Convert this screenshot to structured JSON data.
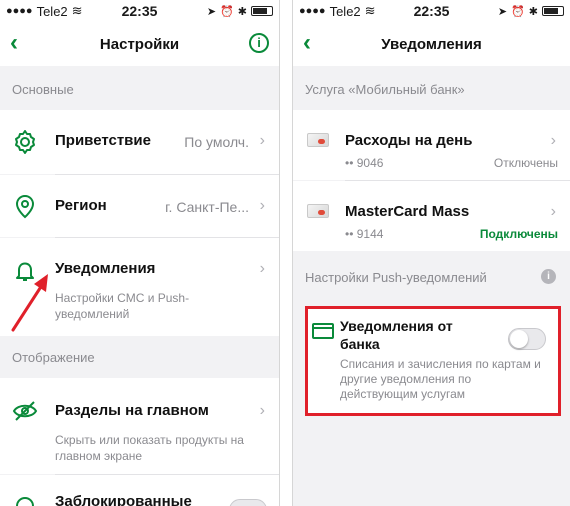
{
  "colors": {
    "accent": "#0a8a3a",
    "highlight": "#e0202a",
    "muted": "#8a8a8f"
  },
  "status": {
    "carrier": "Tele2",
    "time": "22:35"
  },
  "left": {
    "title": "Настройки",
    "sections": {
      "basic": "Основные",
      "display": "Отображение"
    },
    "items": {
      "greeting": {
        "label": "Приветствие",
        "value": "По умолч.",
        "icon": "gear-icon"
      },
      "region": {
        "label": "Регион",
        "value": "г. Санкт-Пе...",
        "icon": "location-pin-icon"
      },
      "notifications": {
        "label": "Уведомления",
        "sub": "Настройки СМС и Push-уведомлений",
        "icon": "bell-icon"
      },
      "sections_main": {
        "label": "Разделы на главном",
        "sub": "Скрыть или показать продукты на главном экране",
        "icon": "eye-slash-icon"
      },
      "blocked": {
        "label": "Заблокированные"
      }
    }
  },
  "right": {
    "title": "Уведомления",
    "service_header": "Услуга «Мобильный банк»",
    "cards": [
      {
        "name": "Расходы на день",
        "number": "•• 9046",
        "status": "Отключены",
        "enabled": false
      },
      {
        "name": "MasterCard Mass",
        "number": "•• 9144",
        "status": "Подключены",
        "enabled": true
      }
    ],
    "push_header": "Настройки Push-уведомлений",
    "bank_notifications": {
      "label": "Уведомления от банка",
      "sub": "Списания и зачисления по картам и другие уведомления по действующим услугам",
      "enabled": false
    }
  }
}
